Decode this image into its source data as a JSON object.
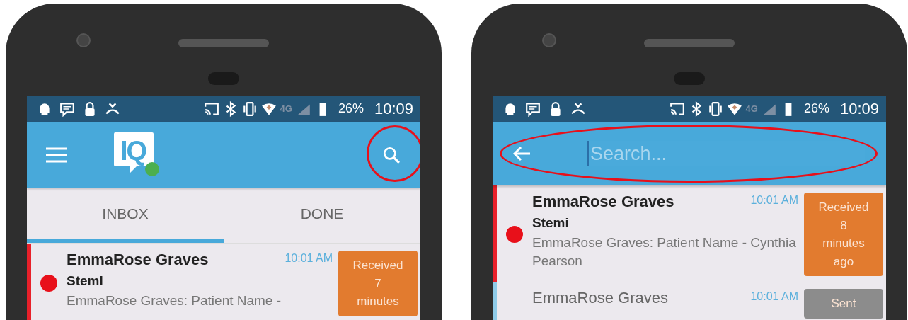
{
  "phones": [
    {
      "status_bar": {
        "network": "4G",
        "battery_text": "26%",
        "time": "10:09"
      },
      "app_bar": {
        "kind": "logo",
        "logo_text": "IQ",
        "online": true,
        "highlighted": true
      },
      "tabs": [
        {
          "label": "INBOX",
          "selected": true
        },
        {
          "label": "DONE",
          "selected": false
        }
      ],
      "messages": [
        {
          "sender": "EmmaRose Graves",
          "time": "10:01 AM",
          "subject": "Stemi",
          "preview": "EmmaRose Graves: Patient Name -",
          "unread": true,
          "priority_dot": true,
          "color": "#e8202a",
          "badge": {
            "kind": "received",
            "lines": [
              "Received",
              "7",
              "minutes"
            ]
          }
        }
      ]
    },
    {
      "status_bar": {
        "network": "4G",
        "battery_text": "26%",
        "time": "10:09"
      },
      "app_bar": {
        "kind": "search",
        "placeholder": "Search...",
        "highlighted": true
      },
      "messages": [
        {
          "sender": "EmmaRose Graves",
          "time": "10:01 AM",
          "subject": "Stemi",
          "preview": "EmmaRose Graves: Patient Name - Cynthia Pearson",
          "unread": true,
          "priority_dot": true,
          "color": "#e8202a",
          "badge": {
            "kind": "received",
            "lines": [
              "Received",
              "8",
              "minutes",
              "ago"
            ]
          }
        },
        {
          "sender": "EmmaRose Graves",
          "time": "10:01 AM",
          "unread": false,
          "priority_dot": false,
          "color": "#8fcbe8",
          "badge": {
            "kind": "sent",
            "lines": [
              "Sent"
            ]
          }
        }
      ]
    }
  ]
}
